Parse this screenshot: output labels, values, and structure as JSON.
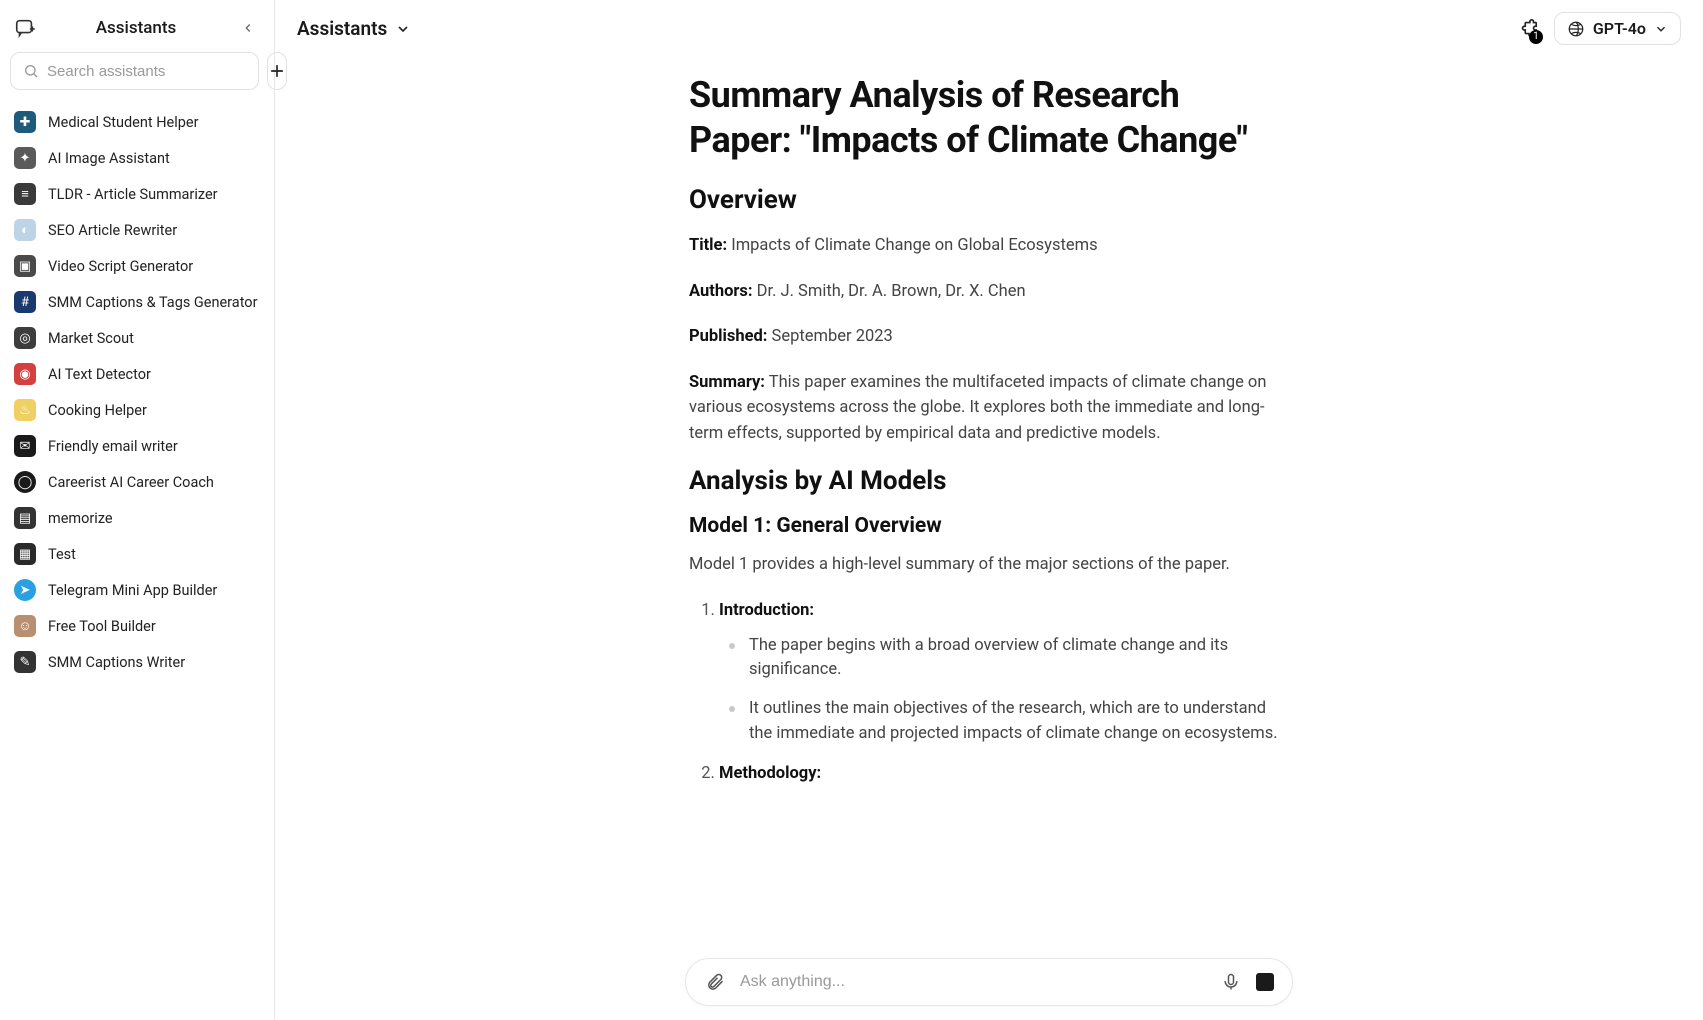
{
  "sidebar": {
    "title": "Assistants",
    "search_placeholder": "Search assistants",
    "items": [
      {
        "label": "Medical Student Helper"
      },
      {
        "label": "AI Image Assistant"
      },
      {
        "label": "TLDR - Article Summarizer"
      },
      {
        "label": "SEO Article Rewriter"
      },
      {
        "label": "Video Script Generator"
      },
      {
        "label": "SMM Captions & Tags Generator"
      },
      {
        "label": "Market Scout"
      },
      {
        "label": "AI Text Detector"
      },
      {
        "label": "Cooking Helper"
      },
      {
        "label": "Friendly email writer"
      },
      {
        "label": "Careerist AI Career Coach"
      },
      {
        "label": "memorize"
      },
      {
        "label": "Test"
      },
      {
        "label": "Telegram Mini App Builder"
      },
      {
        "label": "Free Tool Builder"
      },
      {
        "label": "SMM Captions Writer"
      }
    ]
  },
  "header": {
    "breadcrumb": "Assistants",
    "extension_count": "1",
    "model": "GPT-4o"
  },
  "doc": {
    "h1": "Summary Analysis of Research Paper: \"Impacts of Climate Change\"",
    "h2_overview": "Overview",
    "title_label": "Title:",
    "title_value": " Impacts of Climate Change on Global Ecosystems",
    "authors_label": "Authors:",
    "authors_value": " Dr. J. Smith, Dr. A. Brown, Dr. X. Chen",
    "published_label": "Published:",
    "published_value": " September 2023",
    "summary_label": "Summary:",
    "summary_value": " This paper examines the multifaceted impacts of climate change on various ecosystems across the globe. It explores both the immediate and long-term effects, supported by empirical data and predictive models.",
    "h2_analysis": "Analysis by AI Models",
    "h3_model1": "Model 1: General Overview",
    "model1_intro": "Model 1 provides a high-level summary of the major sections of the paper.",
    "ol": [
      {
        "label": "Introduction:",
        "bullets": [
          "The paper begins with a broad overview of climate change and its significance.",
          "It outlines the main objectives of the research, which are to understand the immediate and projected impacts of climate change on ecosystems."
        ]
      },
      {
        "label": "Methodology:",
        "bullets": []
      }
    ]
  },
  "input": {
    "placeholder": "Ask anything..."
  }
}
